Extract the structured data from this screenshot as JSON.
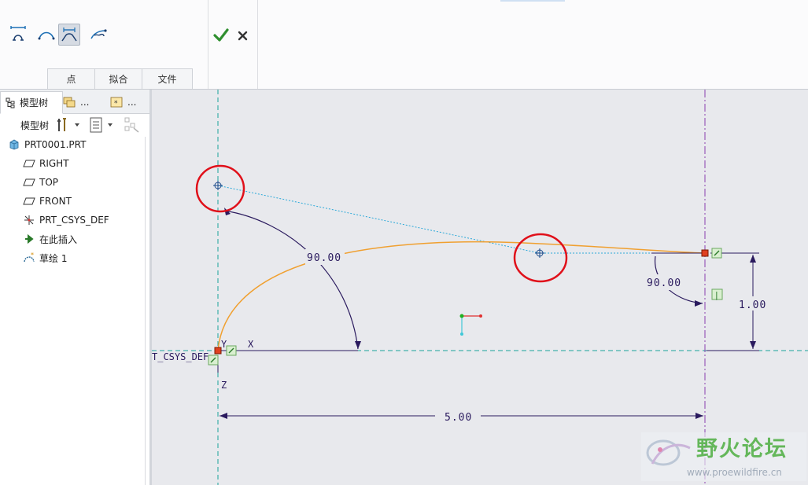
{
  "ribbon": {
    "tools": [
      {
        "name": "dimension-tool-icon"
      },
      {
        "name": "arc-curve-tool-icon"
      },
      {
        "name": "fit-tool-icon",
        "active": true
      },
      {
        "name": "hand-adjust-tool-icon"
      }
    ],
    "accept_icon": "checkmark-icon",
    "cancel_icon": "close-icon",
    "tabs": [
      "点",
      "拟合",
      "文件"
    ]
  },
  "panel": {
    "tabs": [
      {
        "label": "模型树",
        "icon": "tree-icon",
        "selected": true
      },
      {
        "label": "...",
        "icon": "layers-icon"
      },
      {
        "label": "...",
        "icon": "favorites-icon"
      }
    ],
    "toolbar_label": "模型树",
    "tree": [
      {
        "label": "PRT0001.PRT",
        "icon": "part-icon",
        "indent": 0
      },
      {
        "label": "RIGHT",
        "icon": "datum-plane-icon",
        "indent": 1
      },
      {
        "label": "TOP",
        "icon": "datum-plane-icon",
        "indent": 1
      },
      {
        "label": "FRONT",
        "icon": "datum-plane-icon",
        "indent": 1
      },
      {
        "label": "PRT_CSYS_DEF",
        "icon": "csys-icon",
        "indent": 1
      },
      {
        "label": "在此插入",
        "icon": "insert-arrow-icon",
        "indent": 1
      },
      {
        "label": "草绘 1",
        "icon": "sketch-icon",
        "indent": 1
      }
    ]
  },
  "canvas": {
    "dims": {
      "left_angle": "90.00",
      "right_angle": "90.00",
      "height": "1.00",
      "width": "5.00"
    },
    "csys_label": "T_CSYS_DEF",
    "axis_x": "X",
    "axis_y": "Y",
    "axis_z": "Z",
    "constraint_marker": "|"
  },
  "watermark": {
    "title": "野火论坛",
    "url": "www.proewildfire.cn"
  },
  "colors": {
    "curve": "#f0a030",
    "dimension": "#2a1a5e",
    "centerline": "#1aa39a",
    "annotation_circle": "#e0101a"
  }
}
